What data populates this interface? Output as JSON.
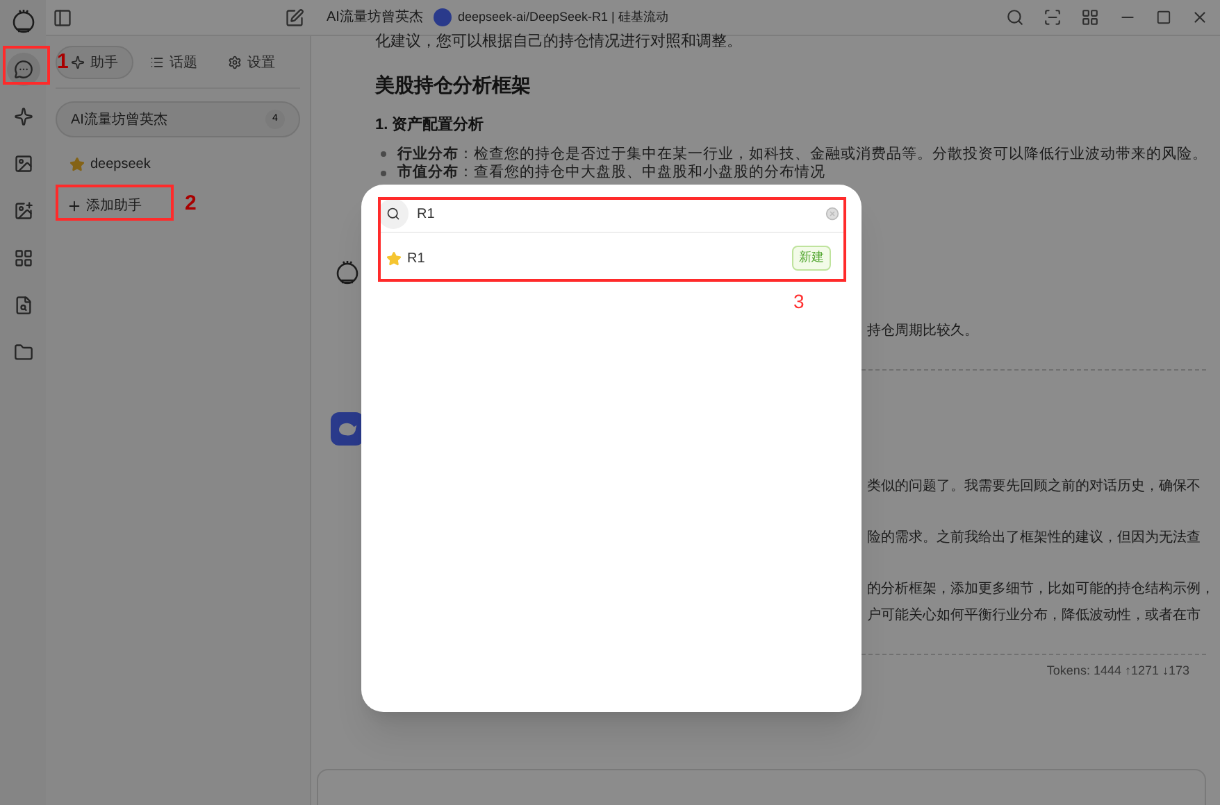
{
  "titlebar": {
    "assistant_name": "AI流量坊曾英杰",
    "model": "deepseek-ai/DeepSeek-R1 | 硅基流动"
  },
  "nav": [
    {
      "kind": "chat",
      "selected": true
    },
    {
      "kind": "sparkle",
      "selected": false
    },
    {
      "kind": "image",
      "selected": false
    },
    {
      "kind": "image-edit",
      "selected": false
    },
    {
      "kind": "apps",
      "selected": false
    },
    {
      "kind": "doc-search",
      "selected": false
    },
    {
      "kind": "folder",
      "selected": false
    }
  ],
  "sidebar": {
    "tabs": [
      {
        "label": "助手",
        "kind": "sparkle",
        "selected": true
      },
      {
        "label": "话题",
        "kind": "list",
        "selected": false
      },
      {
        "label": "设置",
        "kind": "gear",
        "selected": false
      }
    ],
    "assistants": [
      {
        "name": "AI流量坊曾英杰",
        "count": "4",
        "selected": true
      },
      {
        "name": "deepseek",
        "selected": false
      }
    ],
    "add_button": "添加助手"
  },
  "chat": {
    "blocks": [
      {
        "kind": "text",
        "text": "化建议，您可以根据自己的持仓情况进行对照和调整。"
      },
      {
        "kind": "heading",
        "text": "美股持仓分析框架"
      },
      {
        "kind": "subheading",
        "text": "1. 资产配置分析"
      },
      {
        "kind": "bullet",
        "text": "**行业分布**：检查您的持仓是否过于集中在某一行业，如科技、金融或消费品等。分散投资可以降低行业波动带来的风险。"
      },
      {
        "kind": "bullet",
        "text": "**市值分布**：查看您的持仓中大盘股、中盘股和小盘股的分布情况"
      },
      {
        "kind": "avatar-user"
      },
      {
        "kind": "fragment",
        "text": "持仓周期比较久。"
      },
      {
        "kind": "divider"
      },
      {
        "kind": "avatar-bot"
      },
      {
        "kind": "fragment",
        "text": "类似的问题了。我需要先回顾之前的对话历史，确保不"
      },
      {
        "kind": "fragment",
        "text": "险的需求。之前我给出了框架性的建议，但因为无法查"
      },
      {
        "kind": "fragment",
        "text": "的分析框架，添加更多细节，比如可能的持仓结构示例，"
      },
      {
        "kind": "fragment-tight",
        "text": "户可能关心如何平衡行业分布，降低波动性，或者在市"
      },
      {
        "kind": "divider"
      },
      {
        "kind": "tokens",
        "text": "Tokens: 1444 ↑1271 ↓173"
      }
    ]
  },
  "modal": {
    "search": {
      "value": "R1"
    },
    "results": [
      {
        "name": "R1",
        "badge": "新建"
      }
    ]
  },
  "annotations": [
    "1",
    "2",
    "3"
  ]
}
